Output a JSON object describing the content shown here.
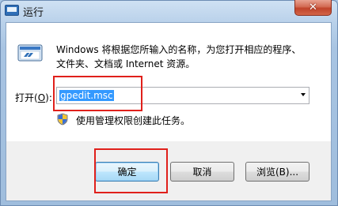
{
  "window": {
    "title": "运行",
    "close_label": "✕"
  },
  "description": {
    "line1": "Windows 将根据您所输入的名称，为您打开相应的程序、",
    "line2": "文件夹、文档或 Internet 资源。"
  },
  "open_field": {
    "label_prefix": "打开(",
    "label_accel": "O",
    "label_suffix": "):",
    "value": "gpedit.msc"
  },
  "admin_note": "使用管理权限创建此任务。",
  "buttons": {
    "ok": "确定",
    "cancel": "取消",
    "browse": "浏览(B)..."
  },
  "icons": {
    "title": "run-app-icon",
    "run": "run-program-icon",
    "shield": "uac-shield-icon",
    "dropdown": "dropdown-arrow-icon"
  },
  "colors": {
    "highlight_box": "#e0201b",
    "selection": "#3399ff",
    "close": "#c0432a"
  }
}
